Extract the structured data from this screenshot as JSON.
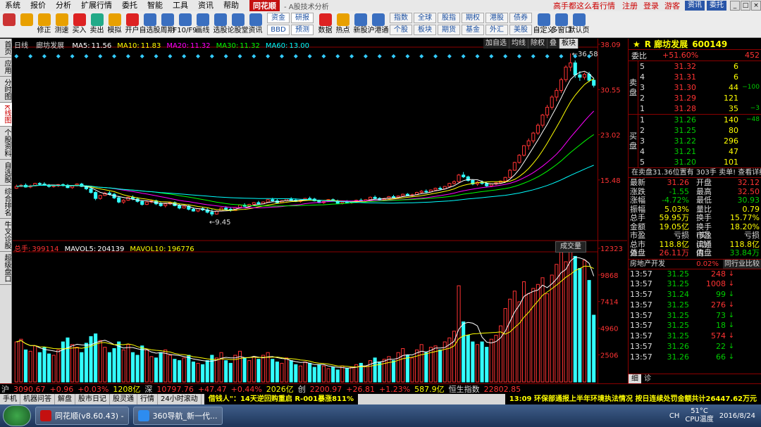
{
  "menu": {
    "items": [
      "系统",
      "报价",
      "分析",
      "扩展行情",
      "委托",
      "智能",
      "工具",
      "资讯",
      "帮助"
    ],
    "brand": "同花顺",
    "subtitle": "- A股技术分析",
    "promo": "高手都这么看行情",
    "register": "注册",
    "login": "登录",
    "guest": "游客",
    "info_btn": "资讯",
    "trade_btn": "委托"
  },
  "toolbar": {
    "buttons": [
      {
        "label": "",
        "icon": "grid-icon",
        "color": "#c33"
      },
      {
        "label": "",
        "icon": "back-icon",
        "color": "#e8a000"
      },
      {
        "label": "修正",
        "icon": "up-down-icon",
        "color": "#e8a000"
      },
      {
        "label": "测速",
        "icon": "speed-icon",
        "color": "#e8a000"
      },
      {
        "label": "买入",
        "icon": "buy-icon",
        "color": "#d22"
      },
      {
        "label": "卖出",
        "icon": "sell-icon",
        "color": "#2a8"
      },
      {
        "label": "模拟",
        "icon": "simulate-icon",
        "color": "#e8a000"
      },
      {
        "label": "开户",
        "icon": "account-icon",
        "color": "#d22"
      },
      {
        "label": "自选股",
        "icon": "watchlist-icon",
        "color": "#3a6fc0"
      },
      {
        "label": "周期",
        "icon": "period-icon",
        "color": "#3a6fc0"
      },
      {
        "label": "F10/F9",
        "icon": "f10-icon",
        "color": "#3a6fc0"
      },
      {
        "label": "画线",
        "icon": "draw-icon",
        "color": "#3a6fc0"
      },
      {
        "label": "选股",
        "icon": "select-icon",
        "color": "#3a6fc0"
      },
      {
        "label": "论股堂",
        "icon": "forum-icon",
        "color": "#3a6fc0"
      },
      {
        "label": "资讯",
        "icon": "news-icon",
        "color": "#3a6fc0"
      }
    ],
    "group1": [
      "资金",
      "研报",
      "BBD",
      "预测"
    ],
    "buttons2": [
      {
        "label": "数据",
        "icon": "data-icon",
        "color": "#d22"
      },
      {
        "label": "热点",
        "icon": "hot-icon",
        "color": "#e8a000"
      },
      {
        "label": "新股",
        "icon": "ipo-icon",
        "color": "#3a6fc0"
      },
      {
        "label": "沪港通",
        "icon": "hk-icon",
        "color": "#3a6fc0"
      }
    ],
    "group2": [
      "指数",
      "全球",
      "股指",
      "期权",
      "港股",
      "债券",
      "个股",
      "板块",
      "期货",
      "基金",
      "外汇",
      "美股"
    ],
    "buttons3": [
      {
        "label": "自定义",
        "icon": "custom-icon",
        "color": "#3a6fc0"
      },
      {
        "label": "多窗口",
        "icon": "multiwin-icon",
        "color": "#3a6fc0"
      },
      {
        "label": "默认页",
        "icon": "home-icon",
        "color": "#3a6fc0"
      }
    ]
  },
  "left_tabs": [
    "首页",
    "应用",
    "分时图",
    "K线图",
    "个股资料",
    "自选股",
    "综合排名",
    "牛叉诊股",
    "超级盘口"
  ],
  "chart": {
    "period": "日线",
    "name": "廊坊发展",
    "ma": [
      {
        "k": "MA5:",
        "v": "11.56",
        "c": "#fff"
      },
      {
        "k": "MA10:",
        "v": "11.83",
        "c": "#ff0"
      },
      {
        "k": "MA20:",
        "v": "11.32",
        "c": "#f0f"
      },
      {
        "k": "MA30:",
        "v": "11.32",
        "c": "#0f0"
      },
      {
        "k": "MA60:",
        "v": "13.00",
        "c": "#0ff"
      }
    ],
    "buttons": [
      "加自选",
      "均线",
      "除权",
      "叠",
      "板块"
    ],
    "active_button": "板块",
    "price_ticks": [
      "38.09",
      "30.55",
      "23.02",
      "15.48"
    ],
    "high_label": "36.58",
    "low_label": "9.45",
    "vol_legend": [
      {
        "k": "总手:",
        "v": "399114",
        "c": "#f33"
      },
      {
        "k": "MAVOL5:",
        "v": "204139",
        "c": "#fff"
      },
      {
        "k": "MAVOL10:",
        "v": "196776",
        "c": "#ff0"
      }
    ],
    "vol_btn": "成交量",
    "vol_ticks": [
      "12323",
      "9868",
      "7414",
      "4960",
      "2506"
    ]
  },
  "chart_data": {
    "type": "candlestick",
    "title": "廊坊发展 日线",
    "price_ylim": [
      5.96,
      38.09
    ],
    "high": 36.58,
    "low": 9.45,
    "ma_last": {
      "MA5": 11.56,
      "MA10": 11.83,
      "MA20": 11.32,
      "MA30": 11.32,
      "MA60": 13.0
    },
    "volume_ylim": [
      0,
      12323
    ],
    "volume_last": 399114,
    "mavol5": 204139,
    "mavol10": 196776,
    "candles": [
      [
        14.1,
        14.7,
        14.0,
        14.4
      ],
      [
        14.4,
        14.8,
        14.3,
        14.6
      ],
      [
        14.6,
        14.9,
        14.2,
        14.3
      ],
      [
        14.3,
        14.7,
        14.1,
        14.5
      ],
      [
        14.5,
        15.0,
        14.4,
        14.9
      ],
      [
        14.9,
        15.1,
        14.6,
        14.8
      ],
      [
        14.8,
        15.1,
        14.5,
        14.6
      ],
      [
        14.6,
        14.8,
        14.2,
        14.4
      ],
      [
        14.4,
        14.7,
        14.2,
        14.5
      ],
      [
        14.5,
        14.8,
        14.3,
        14.7
      ],
      [
        14.7,
        14.9,
        14.4,
        14.6
      ],
      [
        14.6,
        14.8,
        14.1,
        14.2
      ],
      [
        14.2,
        14.6,
        14.0,
        14.5
      ],
      [
        14.5,
        14.9,
        14.4,
        14.8
      ],
      [
        14.8,
        15.0,
        14.3,
        14.4
      ],
      [
        14.4,
        14.6,
        13.8,
        14.0
      ],
      [
        14.0,
        14.3,
        13.2,
        13.4
      ],
      [
        13.4,
        13.6,
        12.1,
        12.4
      ],
      [
        12.4,
        13.0,
        12.2,
        12.9
      ],
      [
        12.9,
        13.5,
        12.8,
        13.3
      ],
      [
        13.3,
        13.6,
        12.9,
        13.1
      ],
      [
        13.1,
        13.3,
        12.3,
        12.5
      ],
      [
        12.5,
        12.8,
        11.6,
        11.8
      ],
      [
        11.8,
        12.3,
        11.5,
        12.1
      ],
      [
        12.1,
        12.7,
        12.0,
        12.6
      ],
      [
        12.6,
        12.9,
        12.1,
        12.3
      ],
      [
        12.3,
        12.6,
        11.7,
        11.9
      ],
      [
        11.9,
        12.1,
        11.2,
        11.4
      ],
      [
        11.4,
        11.9,
        11.3,
        11.8
      ],
      [
        11.8,
        12.2,
        11.6,
        12.0
      ],
      [
        12.0,
        12.2,
        11.3,
        11.5
      ],
      [
        11.5,
        11.8,
        11.0,
        11.2
      ],
      [
        11.2,
        11.6,
        10.9,
        11.5
      ],
      [
        11.5,
        11.9,
        11.3,
        11.7
      ],
      [
        11.7,
        11.9,
        11.1,
        11.2
      ],
      [
        11.2,
        11.5,
        10.6,
        10.8
      ],
      [
        10.8,
        11.3,
        10.7,
        11.1
      ],
      [
        11.1,
        11.4,
        10.4,
        10.6
      ],
      [
        10.6,
        10.9,
        10.2,
        10.3
      ],
      [
        10.3,
        10.8,
        10.1,
        10.7
      ],
      [
        10.7,
        11.0,
        10.3,
        10.5
      ],
      [
        10.5,
        10.8,
        9.9,
        10.1
      ],
      [
        10.1,
        10.6,
        9.45,
        9.8
      ],
      [
        9.8,
        10.4,
        9.7,
        10.3
      ],
      [
        10.3,
        10.9,
        10.2,
        10.8
      ],
      [
        10.8,
        11.1,
        10.5,
        10.6
      ],
      [
        10.6,
        10.9,
        10.2,
        10.4
      ],
      [
        10.4,
        11.0,
        10.3,
        10.9
      ],
      [
        10.9,
        11.4,
        10.8,
        11.3
      ],
      [
        11.3,
        11.6,
        11.0,
        11.1
      ],
      [
        11.1,
        11.5,
        10.9,
        11.4
      ],
      [
        11.4,
        11.8,
        11.3,
        11.7
      ],
      [
        11.7,
        12.0,
        11.4,
        11.5
      ],
      [
        11.5,
        11.9,
        11.4,
        11.8
      ],
      [
        11.8,
        12.3,
        11.7,
        12.2
      ],
      [
        12.2,
        12.5,
        11.9,
        12.0
      ],
      [
        12.0,
        12.3,
        11.6,
        11.7
      ],
      [
        11.7,
        12.1,
        11.6,
        12.0
      ],
      [
        12.0,
        12.4,
        11.9,
        12.3
      ],
      [
        12.3,
        12.6,
        12.0,
        12.1
      ],
      [
        12.1,
        12.4,
        11.8,
        11.9
      ],
      [
        11.9,
        12.2,
        11.7,
        12.1
      ],
      [
        12.1,
        12.5,
        12.0,
        12.4
      ],
      [
        12.4,
        12.7,
        12.2,
        12.3
      ],
      [
        12.3,
        12.5,
        11.9,
        12.0
      ],
      [
        12.0,
        12.2,
        11.6,
        11.7
      ],
      [
        11.7,
        12.0,
        11.5,
        11.9
      ],
      [
        11.9,
        12.3,
        11.8,
        12.2
      ],
      [
        12.2,
        12.4,
        11.9,
        12.0
      ],
      [
        12.0,
        12.2,
        11.5,
        11.6
      ],
      [
        11.6,
        11.9,
        11.4,
        11.8
      ],
      [
        11.8,
        12.1,
        11.6,
        11.7
      ],
      [
        11.7,
        12.0,
        11.5,
        11.9
      ],
      [
        11.9,
        12.2,
        11.7,
        12.1
      ],
      [
        12.1,
        12.4,
        11.9,
        12.0
      ],
      [
        12.0,
        12.3,
        11.8,
        12.2
      ],
      [
        12.2,
        12.7,
        12.1,
        12.6
      ],
      [
        12.6,
        12.9,
        12.3,
        12.4
      ],
      [
        12.4,
        12.6,
        12.0,
        12.2
      ],
      [
        12.2,
        12.5,
        12.0,
        12.4
      ],
      [
        12.4,
        12.8,
        12.3,
        12.7
      ],
      [
        12.7,
        13.0,
        12.5,
        12.6
      ],
      [
        12.6,
        12.9,
        12.4,
        12.8
      ],
      [
        12.8,
        13.2,
        12.7,
        13.1
      ],
      [
        13.1,
        13.3,
        12.8,
        12.9
      ],
      [
        12.9,
        13.2,
        12.7,
        13.0
      ],
      [
        13.0,
        13.5,
        12.9,
        13.4
      ],
      [
        13.4,
        13.8,
        13.2,
        13.6
      ],
      [
        13.6,
        13.9,
        13.3,
        13.5
      ],
      [
        13.5,
        13.9,
        13.4,
        13.8
      ],
      [
        13.8,
        14.2,
        13.7,
        14.1
      ],
      [
        14.1,
        14.4,
        13.8,
        14.0
      ],
      [
        14.0,
        14.5,
        13.9,
        14.4
      ],
      [
        14.4,
        15.0,
        14.3,
        14.9
      ],
      [
        14.9,
        15.4,
        14.7,
        15.2
      ],
      [
        15.2,
        16.5,
        15.0,
        16.3
      ],
      [
        16.3,
        16.8,
        15.8,
        16.0
      ],
      [
        16.0,
        16.2,
        15.2,
        15.4
      ],
      [
        15.4,
        15.6,
        14.6,
        14.8
      ],
      [
        14.8,
        15.3,
        14.5,
        15.1
      ],
      [
        15.1,
        15.4,
        14.7,
        14.9
      ],
      [
        14.9,
        15.2,
        14.3,
        14.5
      ],
      [
        14.5,
        14.9,
        14.3,
        14.8
      ],
      [
        14.8,
        15.1,
        14.6,
        15.0
      ],
      [
        15.0,
        15.4,
        14.8,
        15.3
      ],
      [
        15.3,
        16.0,
        15.1,
        15.9
      ],
      [
        15.9,
        17.3,
        15.8,
        17.1
      ],
      [
        17.1,
        18.5,
        17.0,
        18.4
      ],
      [
        18.4,
        19.8,
        18.2,
        19.6
      ],
      [
        19.6,
        21.3,
        19.4,
        21.2
      ],
      [
        21.2,
        22.4,
        20.5,
        22.0
      ],
      [
        22.0,
        23.5,
        21.6,
        23.3
      ],
      [
        23.3,
        24.9,
        23.0,
        24.6
      ],
      [
        24.6,
        26.5,
        24.2,
        26.3
      ],
      [
        26.3,
        28.0,
        25.8,
        27.6
      ],
      [
        27.6,
        29.6,
        27.2,
        29.3
      ],
      [
        29.3,
        30.8,
        28.6,
        30.4
      ],
      [
        30.4,
        32.5,
        30.0,
        32.2
      ],
      [
        32.2,
        34.6,
        31.8,
        34.3
      ],
      [
        34.3,
        36.58,
        33.6,
        35.0
      ],
      [
        35.0,
        35.4,
        32.5,
        33.0
      ],
      [
        33.0,
        33.6,
        32.0,
        32.6
      ],
      [
        32.6,
        33.4,
        32.2,
        33.1
      ],
      [
        33.1,
        33.5,
        31.8,
        32.1
      ],
      [
        32.1,
        32.5,
        30.9,
        31.26
      ]
    ],
    "volumes": [
      0.3,
      0.32,
      0.24,
      0.23,
      0.27,
      0.22,
      0.26,
      0.21,
      0.2,
      0.24,
      0.3,
      0.33,
      0.28,
      0.26,
      0.22,
      0.29,
      0.34,
      0.36,
      0.31,
      0.26,
      0.22,
      0.25,
      0.3,
      0.24,
      0.28,
      0.22,
      0.2,
      0.27,
      0.24,
      0.19,
      0.18,
      0.22,
      0.24,
      0.2,
      0.17,
      0.16,
      0.18,
      0.2,
      0.15,
      0.14,
      0.13,
      0.16,
      0.2,
      0.18,
      0.22,
      0.16,
      0.14,
      0.2,
      0.23,
      0.18,
      0.16,
      0.19,
      0.17,
      0.2,
      0.22,
      0.17,
      0.15,
      0.14,
      0.18,
      0.16,
      0.13,
      0.12,
      0.15,
      0.14,
      0.11,
      0.13,
      0.12,
      0.1,
      0.11,
      0.09,
      0.12,
      0.1,
      0.11,
      0.13,
      0.14,
      0.12,
      0.16,
      0.18,
      0.15,
      0.17,
      0.19,
      0.16,
      0.22,
      0.25,
      0.2,
      0.18,
      0.24,
      0.28,
      0.22,
      0.26,
      0.27,
      0.24,
      0.3,
      0.33,
      0.38,
      0.72,
      0.45,
      0.35,
      0.3,
      0.28,
      0.3,
      0.26,
      0.32,
      0.35,
      0.42,
      0.55,
      0.62,
      0.68,
      0.6,
      0.75,
      0.66,
      0.7,
      0.73,
      0.78,
      0.66,
      0.8,
      0.88,
      0.97,
      0.9,
      0.98,
      0.94,
      0.85,
      0.91,
      0.76,
      0.5
    ]
  },
  "right": {
    "name": "R 廊坊发展",
    "code": "600149",
    "wb_label": "委比",
    "wb_val": "+51.60%",
    "wb_vol": "452",
    "sell_label": "卖盘",
    "buy_label": "买盘",
    "sells": [
      {
        "n": "5",
        "p": "31.32",
        "v": "6",
        "c": ""
      },
      {
        "n": "4",
        "p": "31.31",
        "v": "6",
        "c": ""
      },
      {
        "n": "3",
        "p": "31.30",
        "v": "44",
        "c": "−100"
      },
      {
        "n": "2",
        "p": "31.29",
        "v": "121",
        "c": ""
      },
      {
        "n": "1",
        "p": "31.28",
        "v": "35",
        "c": "−3"
      }
    ],
    "buys": [
      {
        "n": "1",
        "p": "31.26",
        "v": "140",
        "c": "−48"
      },
      {
        "n": "2",
        "p": "31.25",
        "v": "80",
        "c": ""
      },
      {
        "n": "3",
        "p": "31.22",
        "v": "296",
        "c": ""
      },
      {
        "n": "4",
        "p": "31.21",
        "v": "47",
        "c": ""
      },
      {
        "n": "5",
        "p": "31.20",
        "v": "101",
        "c": ""
      }
    ],
    "wb2": "在卖盘31.36位置有  303手  卖单!  查看详细",
    "stats": [
      {
        "k": "最新",
        "v": "31.26",
        "vc": "#f33",
        "k2": "开盘",
        "v2": "32.12",
        "v2c": "#f33"
      },
      {
        "k": "涨跌",
        "v": "-1.55",
        "vc": "#0c0",
        "k2": "最高",
        "v2": "32.50",
        "v2c": "#f33"
      },
      {
        "k": "涨幅",
        "v": "-4.72%",
        "vc": "#0c0",
        "k2": "最低",
        "v2": "30.93",
        "v2c": "#0c0"
      },
      {
        "k": "振幅",
        "v": "5.03%",
        "vc": "#ff0",
        "k2": "量比",
        "v2": "0.79",
        "v2c": "#ff0"
      },
      {
        "k": "总手",
        "v": "59.95万",
        "vc": "#ff0",
        "k2": "换手",
        "v2": "15.77%",
        "v2c": "#ff0"
      },
      {
        "k": "金额",
        "v": "19.05亿",
        "vc": "#ff0",
        "k2": "换手(实)",
        "v2": "18.20%",
        "v2c": "#ff0"
      },
      {
        "k": "市盈",
        "v": "亏损",
        "vc": "#ddd",
        "k2": "市盈(动)",
        "v2": "亏损",
        "v2c": "#ddd"
      },
      {
        "k": "总市值",
        "v": "118.8亿",
        "vc": "#ff0",
        "k2": "流通值",
        "v2": "118.8亿",
        "v2c": "#ff0"
      },
      {
        "k": "外盘",
        "v": "26.11万",
        "vc": "#f33",
        "k2": "内盘",
        "v2": "33.84万",
        "v2c": "#0c0"
      }
    ],
    "sector": {
      "name": "房地产开发",
      "pct": "0.02%",
      "btn": "同行业比较"
    },
    "ticks": [
      {
        "t": "13:57",
        "p": "31.25",
        "v": "248",
        "d": "↓",
        "c": "#f33"
      },
      {
        "t": "13:57",
        "p": "31.25",
        "v": "1008",
        "d": "↓",
        "c": "#f33"
      },
      {
        "t": "13:57",
        "p": "31.24",
        "v": "99",
        "d": "↓",
        "c": "#0c0"
      },
      {
        "t": "13:57",
        "p": "31.25",
        "v": "276",
        "d": "↓",
        "c": "#f33"
      },
      {
        "t": "13:57",
        "p": "31.25",
        "v": "73",
        "d": "↓",
        "c": "#0c0"
      },
      {
        "t": "13:57",
        "p": "31.25",
        "v": "18",
        "d": "↓",
        "c": "#0c0"
      },
      {
        "t": "13:57",
        "p": "31.25",
        "v": "574",
        "d": "↓",
        "c": "#f33"
      },
      {
        "t": "13:57",
        "p": "31.26",
        "v": "22",
        "d": "↓",
        "c": "#0c0"
      },
      {
        "t": "13:57",
        "p": "31.26",
        "v": "66",
        "d": "↓",
        "c": "#0c0"
      }
    ],
    "tabs": [
      "细",
      "诊"
    ]
  },
  "status": {
    "sh": "沪",
    "sh_idx": "3090.67",
    "sh_chg": "+0.96",
    "sh_pct": "+0.03%",
    "sh_amt": "1208亿",
    "sz": "深",
    "sz_idx": "10797.76",
    "sz_chg": "+47.47",
    "sz_pct": "+0.44%",
    "sz_amt": "2026亿",
    "cy": "创",
    "cy_idx": "2200.97",
    "cy_chg": "+26.81",
    "cy_pct": "+1.23%",
    "cy_amt": "587.9亿",
    "hs": "恒生指数",
    "hs_idx": "22802.85"
  },
  "news": {
    "buttons": [
      "手机",
      "机器问答",
      "解盘",
      "股市日记",
      "股灵通",
      "行情",
      "24小时滚动"
    ],
    "ticker1": "借钱人\"：14天逆回购重启 R-001暴涨811%",
    "ticker2": "13:09 环保部通报上半年环境执法情况 按日连续处罚金额共计26447.62万元"
  },
  "taskbar": {
    "tasks": [
      "同花顺(v8.60.43) -",
      "360导航_新一代..."
    ],
    "temp": "51°C",
    "cpu": "CPU温度",
    "date": "2016/8/24",
    "lang": "CH"
  }
}
